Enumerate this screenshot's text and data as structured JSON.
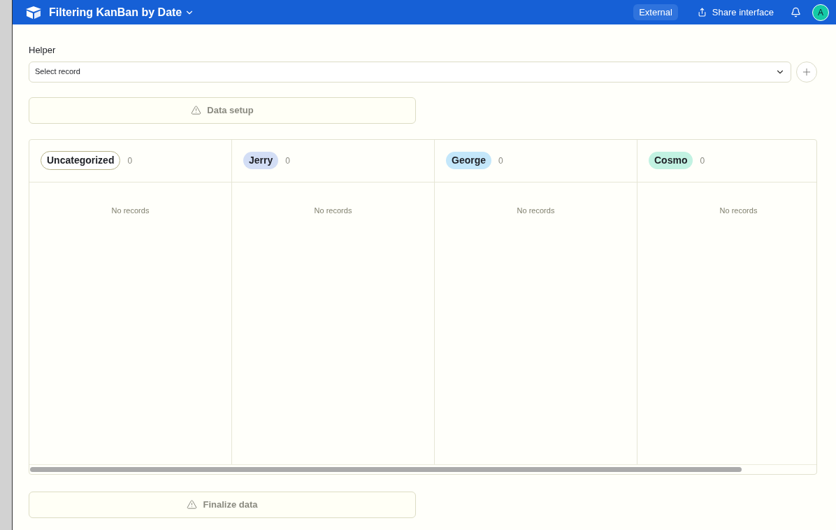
{
  "header": {
    "title": "Filtering KanBan by Date",
    "badge": "External",
    "share_button": "Share interface",
    "avatar": "A"
  },
  "helper": {
    "label": "Helper",
    "placeholder": "Select record"
  },
  "buttons": [
    {
      "label": "Data setup"
    },
    {
      "label": "Finalize data"
    }
  ],
  "board": {
    "columns": [
      {
        "name": "Uncategorized",
        "kind": "outlined",
        "count": "0",
        "empty": "No records"
      },
      {
        "name": "Jerry",
        "kind": "filled",
        "color": "#d3def5",
        "count": "0",
        "empty": "No records"
      },
      {
        "name": "George",
        "kind": "filled",
        "color": "#c4e7fa",
        "count": "0",
        "empty": "No records"
      },
      {
        "name": "Cosmo",
        "kind": "filled",
        "color": "#c2f2e2",
        "count": "0",
        "empty": "No records"
      }
    ]
  }
}
